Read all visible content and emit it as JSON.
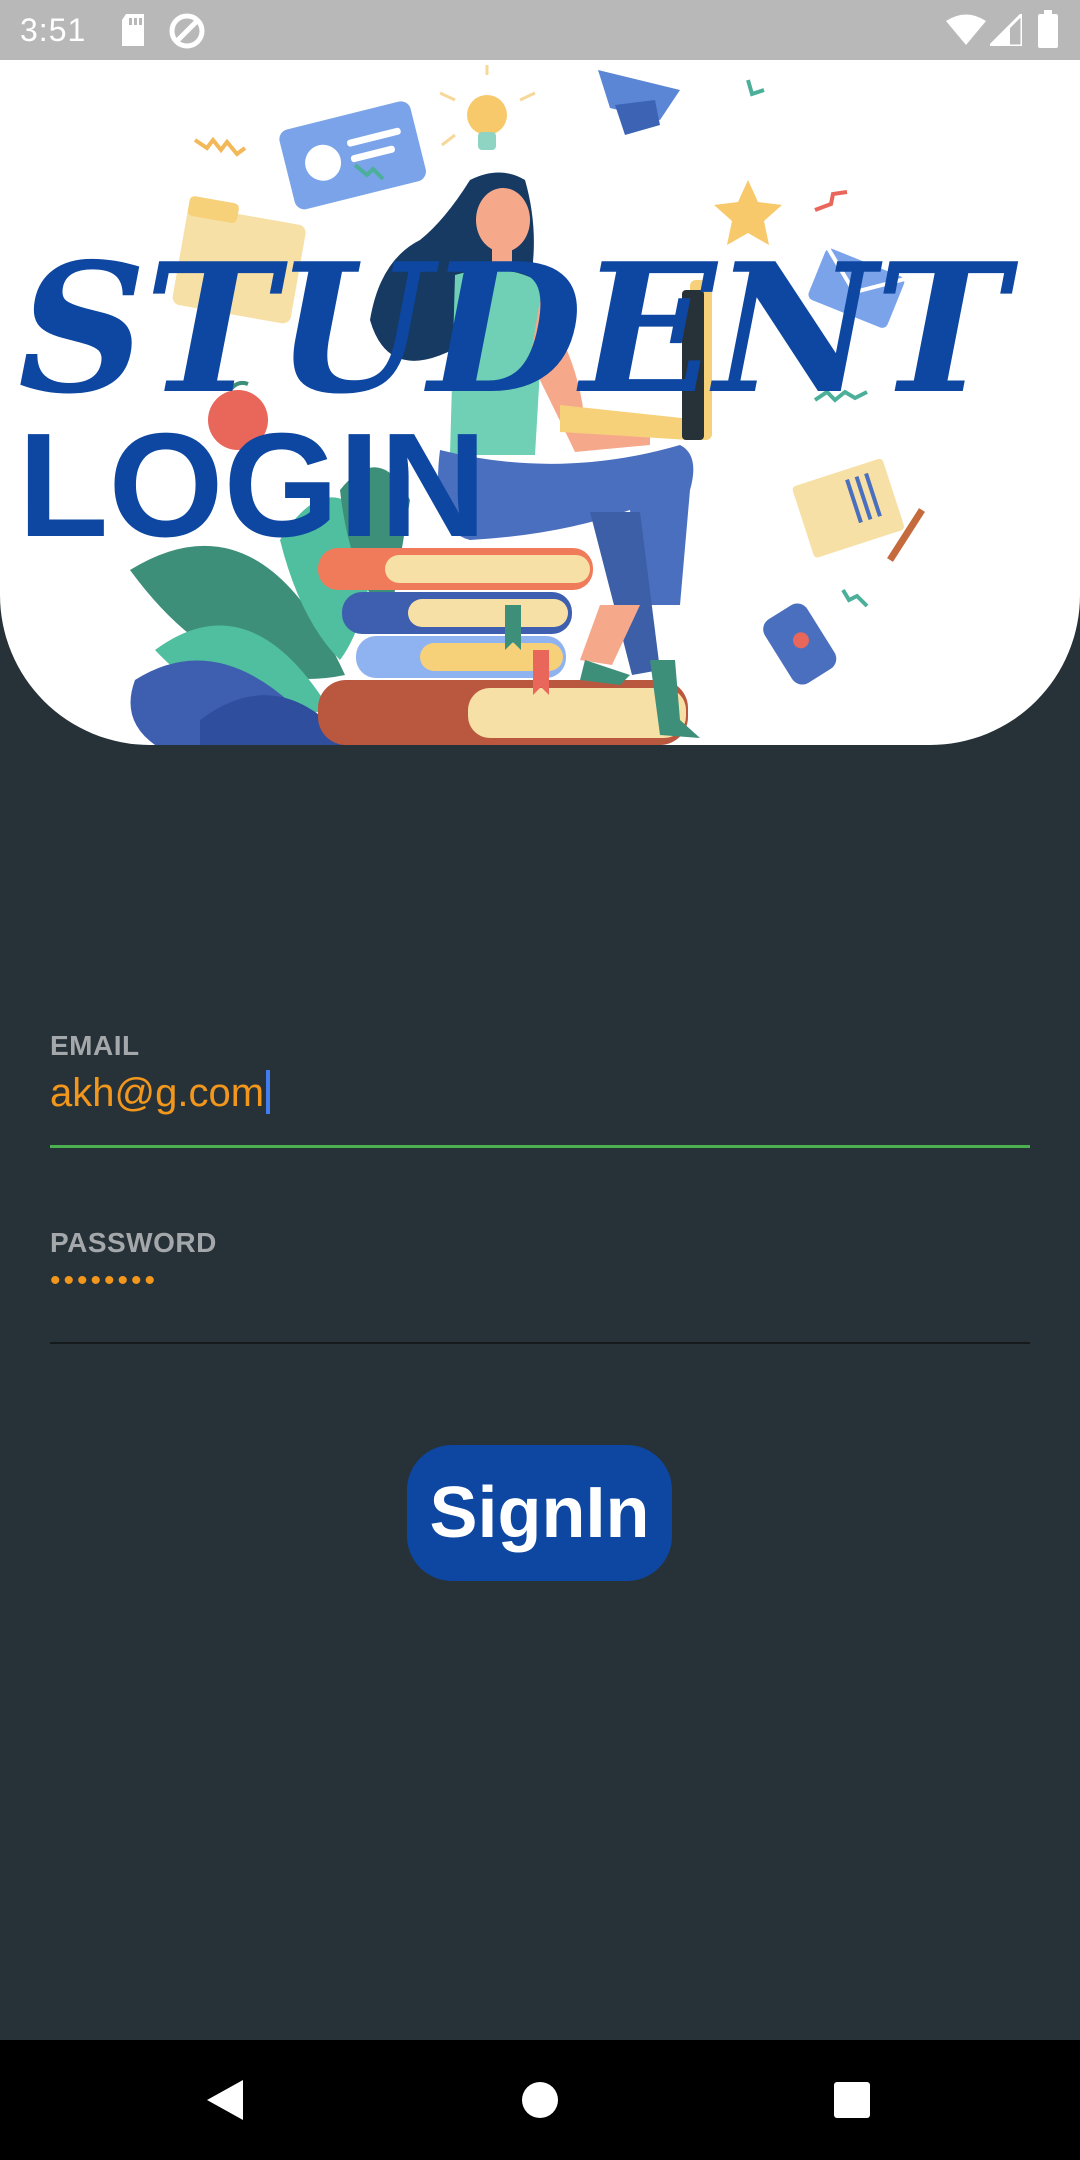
{
  "status_bar": {
    "time": "3:51",
    "icons": [
      "sd-card-icon",
      "data-saver-icon",
      "wifi-icon",
      "signal-icon",
      "battery-icon"
    ]
  },
  "header": {
    "title_line1": "STUDENT",
    "title_line2": "LOGIN"
  },
  "form": {
    "email": {
      "label": "EMAIL",
      "value": "akh@g.com"
    },
    "password": {
      "label": "PASSWORD",
      "value": "••••••••"
    },
    "signin_label": "SignIn"
  },
  "nav_bar": {
    "buttons": [
      "back-icon",
      "home-icon",
      "recents-icon"
    ]
  },
  "colors": {
    "background": "#273238",
    "accent_blue": "#0d47a1",
    "input_text": "#f2971c",
    "focused_line": "#4caf50",
    "label": "#a4a8ab"
  }
}
